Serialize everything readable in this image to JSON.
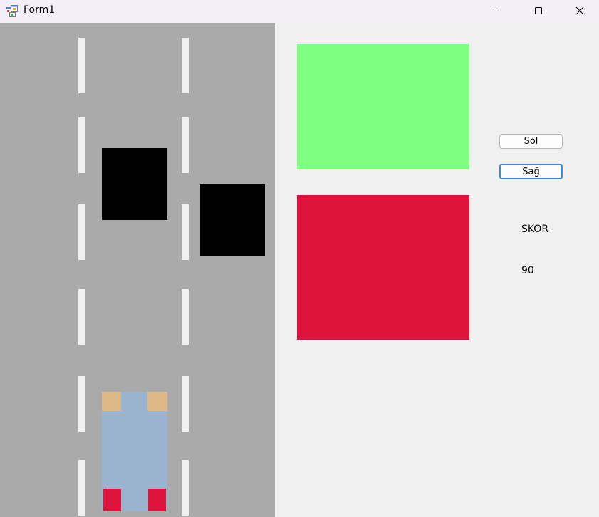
{
  "window": {
    "title": "Form1",
    "icon": "form-app-icon"
  },
  "title_controls": {
    "minimize_icon": "minimize-icon",
    "maximize_icon": "maximize-icon",
    "close_icon": "close-icon"
  },
  "colors": {
    "road": "#aaaaaa",
    "lane_marking": "#f0f0f0",
    "obstacle": "#000000",
    "player_car_body": "#9ab3cf",
    "player_car_headlight": "#deb887",
    "player_car_taillight": "#dc143c",
    "green_panel": "#80ff80",
    "red_panel": "#dc143c",
    "form_background": "#f0f0f0"
  },
  "controls": {
    "left_button_label": "Sol",
    "right_button_label": "Sağ"
  },
  "score": {
    "label": "SKOR",
    "value": "90"
  }
}
